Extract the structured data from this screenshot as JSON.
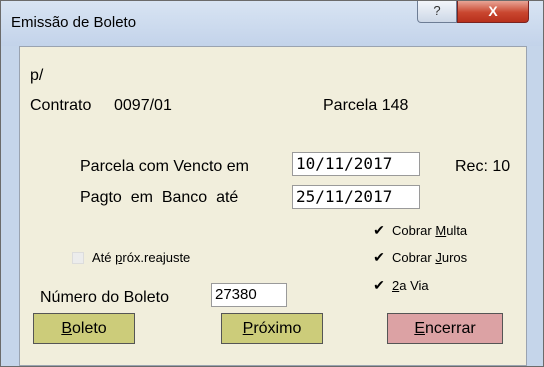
{
  "window": {
    "title": "Emissão de Boleto",
    "help_symbol": "?",
    "close_symbol": "X"
  },
  "header": {
    "prefix": "p/",
    "contrato_label": "Contrato",
    "contrato_value": "0097/01",
    "parcela_text": "Parcela 148"
  },
  "form": {
    "vencto_label": "Parcela com Vencto em",
    "vencto_value": "10/11/2017",
    "rec_text": "Rec: 10",
    "pagto_label": "Pagto  em  Banco  até",
    "pagto_value": "25/11/2017",
    "numero_label": "Número do Boleto",
    "numero_value": "27380"
  },
  "options": {
    "ate_reajuste": {
      "label_pre": "Até ",
      "label_u": "p",
      "label_post": "róx.reajuste",
      "checked": false
    },
    "cobrar_multa": {
      "label_pre": "Cobrar ",
      "label_u": "M",
      "label_post": "ulta",
      "checked": true
    },
    "cobrar_juros": {
      "label_pre": "Cobrar ",
      "label_u": "J",
      "label_post": "uros",
      "checked": true
    },
    "segunda_via": {
      "label_pre": "",
      "label_u": "2",
      "label_post": "a Via",
      "checked": true
    },
    "check_glyph": "✔"
  },
  "buttons": {
    "boleto": {
      "u": "B",
      "rest": "oleto"
    },
    "proximo": {
      "u": "P",
      "rest": "róximo"
    },
    "encerrar": {
      "u": "E",
      "rest": "ncerrar"
    }
  },
  "colors": {
    "title_bar": "#c5d5ea",
    "client_bg": "#f1eedc",
    "button_yellow": "#cccc7a",
    "button_pink": "#dca2a4",
    "close_red": "#c9462f"
  }
}
